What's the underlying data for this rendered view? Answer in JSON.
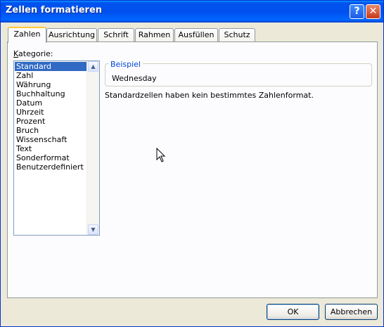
{
  "window": {
    "title": "Zellen formatieren"
  },
  "titlebar_buttons": {
    "help": "?",
    "close": "✕"
  },
  "tabs": [
    {
      "label": "Zahlen",
      "active": true
    },
    {
      "label": "Ausrichtung",
      "active": false
    },
    {
      "label": "Schrift",
      "active": false
    },
    {
      "label": "Rahmen",
      "active": false
    },
    {
      "label": "Ausfüllen",
      "active": false
    },
    {
      "label": "Schutz",
      "active": false
    }
  ],
  "category": {
    "label_accel": "K",
    "label_rest": "ategorie:",
    "selected": "Standard",
    "items": [
      "Standard",
      "Zahl",
      "Währung",
      "Buchhaltung",
      "Datum",
      "Uhrzeit",
      "Prozent",
      "Bruch",
      "Wissenschaft",
      "Text",
      "Sonderformat",
      "Benutzerdefiniert"
    ]
  },
  "sample": {
    "group_label": "Beispiel",
    "value": "Wednesday"
  },
  "description": "Standardzellen haben kein bestimmtes Zahlenformat.",
  "buttons": {
    "ok": "OK",
    "cancel": "Abbrechen"
  }
}
